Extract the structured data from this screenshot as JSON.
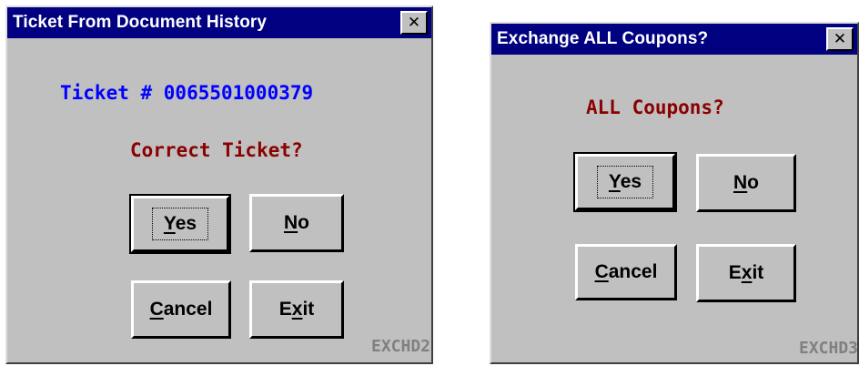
{
  "dialogs": [
    {
      "title": "Ticket From Document History",
      "ticket_label": "Ticket # 0065501000379",
      "question": "Correct Ticket?",
      "buttons": {
        "yes": {
          "before": "",
          "mnemonic": "Y",
          "after": "es"
        },
        "no": {
          "before": "",
          "mnemonic": "N",
          "after": "o"
        },
        "cancel": {
          "before": "",
          "mnemonic": "C",
          "after": "ancel"
        },
        "exit": {
          "before": "E",
          "mnemonic": "x",
          "after": "it"
        }
      },
      "code": "EXCHD2"
    },
    {
      "title": "Exchange ALL Coupons?",
      "question": "ALL Coupons?",
      "buttons": {
        "yes": {
          "before": "",
          "mnemonic": "Y",
          "after": "es"
        },
        "no": {
          "before": "",
          "mnemonic": "N",
          "after": "o"
        },
        "cancel": {
          "before": "",
          "mnemonic": "C",
          "after": "ancel"
        },
        "exit": {
          "before": "E",
          "mnemonic": "x",
          "after": "it"
        }
      },
      "code": "EXCHD3"
    }
  ],
  "icons": {
    "close": "close-icon"
  },
  "colors": {
    "title_bar": "#000080",
    "dialog_face": "#c0c0c0",
    "ticket_text": "#0000ff",
    "question_text": "#8b0000",
    "code_text": "#808080"
  }
}
